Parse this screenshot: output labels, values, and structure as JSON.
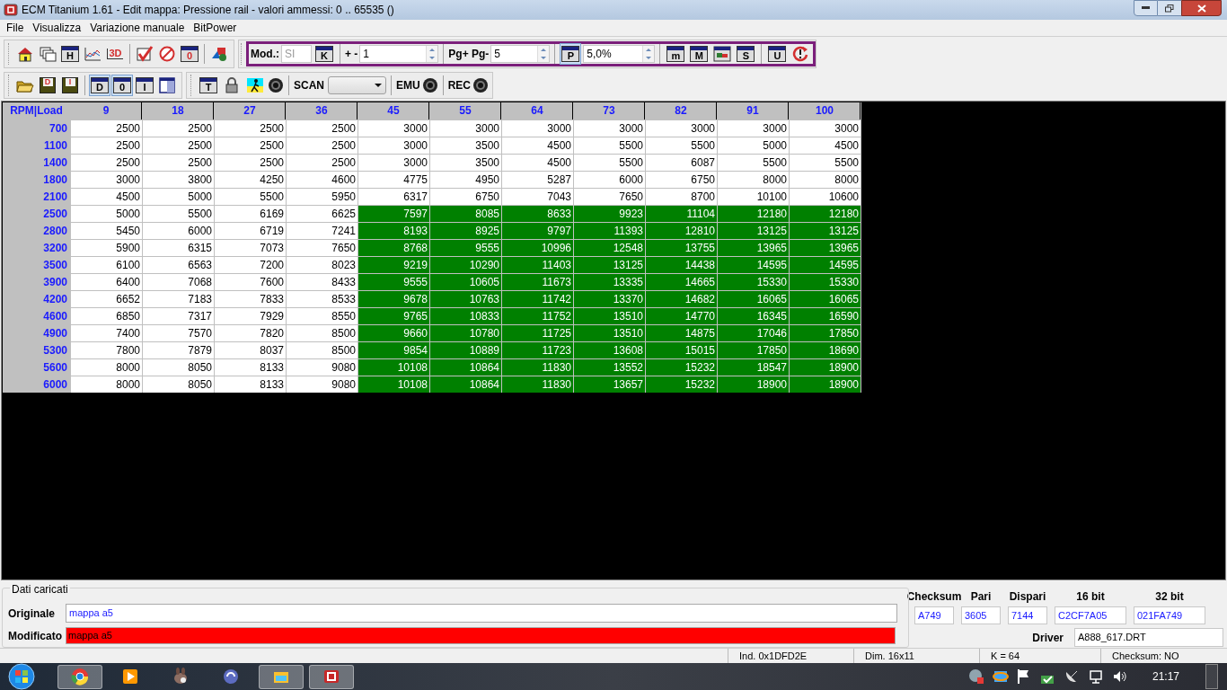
{
  "window": {
    "title": "ECM Titanium 1.61 - Edit mappa: Pressione rail - valori ammessi: 0 .. 65535 ()"
  },
  "menu": [
    "File",
    "Visualizza",
    "Variazione manuale",
    "BitPower"
  ],
  "toolbar_main": {
    "letters": [
      "H",
      "3D",
      "0"
    ]
  },
  "toolbar_edit": {
    "mod_label": "Mod.:",
    "mod_value": "SI",
    "k_letter": "K",
    "step_label": "+ -",
    "step_value": "1",
    "page_label": "Pg+ Pg-",
    "page_value": "5",
    "p_letter": "P",
    "p_selected": true,
    "percent_value": "5,0%",
    "letters": [
      "m",
      "M",
      "S",
      "U"
    ]
  },
  "toolbar_file": {
    "floppy_letters": [
      "D",
      "I"
    ],
    "view_buttons": [
      {
        "letter": "D",
        "selected": true
      },
      {
        "letter": "0",
        "selected": true
      },
      {
        "letter": "I",
        "selected": false
      }
    ]
  },
  "toolbar_scan": {
    "t_letter": "T",
    "scan_label": "SCAN",
    "emu_label": "EMU",
    "rec_label": "REC"
  },
  "table": {
    "corner": "RPM|Load",
    "columns": [
      "9",
      "18",
      "27",
      "36",
      "45",
      "55",
      "64",
      "73",
      "82",
      "91",
      "100"
    ],
    "rows": [
      {
        "rpm": "700",
        "cells": [
          {
            "value": "2500",
            "selected": false
          },
          {
            "value": "2500",
            "selected": false
          },
          {
            "value": "2500",
            "selected": false
          },
          {
            "value": "2500",
            "selected": false
          },
          {
            "value": "3000",
            "selected": false
          },
          {
            "value": "3000",
            "selected": false
          },
          {
            "value": "3000",
            "selected": false
          },
          {
            "value": "3000",
            "selected": false
          },
          {
            "value": "3000",
            "selected": false
          },
          {
            "value": "3000",
            "selected": false
          },
          {
            "value": "3000",
            "selected": false
          }
        ]
      },
      {
        "rpm": "1100",
        "cells": [
          {
            "value": "2500",
            "selected": false
          },
          {
            "value": "2500",
            "selected": false
          },
          {
            "value": "2500",
            "selected": false
          },
          {
            "value": "2500",
            "selected": false
          },
          {
            "value": "3000",
            "selected": false
          },
          {
            "value": "3500",
            "selected": false
          },
          {
            "value": "4500",
            "selected": false
          },
          {
            "value": "5500",
            "selected": false
          },
          {
            "value": "5500",
            "selected": false
          },
          {
            "value": "5000",
            "selected": false
          },
          {
            "value": "4500",
            "selected": false
          }
        ]
      },
      {
        "rpm": "1400",
        "cells": [
          {
            "value": "2500",
            "selected": false
          },
          {
            "value": "2500",
            "selected": false
          },
          {
            "value": "2500",
            "selected": false
          },
          {
            "value": "2500",
            "selected": false
          },
          {
            "value": "3000",
            "selected": false
          },
          {
            "value": "3500",
            "selected": false
          },
          {
            "value": "4500",
            "selected": false
          },
          {
            "value": "5500",
            "selected": false
          },
          {
            "value": "6087",
            "selected": false
          },
          {
            "value": "5500",
            "selected": false
          },
          {
            "value": "5500",
            "selected": false
          }
        ]
      },
      {
        "rpm": "1800",
        "cells": [
          {
            "value": "3000",
            "selected": false
          },
          {
            "value": "3800",
            "selected": false
          },
          {
            "value": "4250",
            "selected": false
          },
          {
            "value": "4600",
            "selected": false
          },
          {
            "value": "4775",
            "selected": false
          },
          {
            "value": "4950",
            "selected": false
          },
          {
            "value": "5287",
            "selected": false
          },
          {
            "value": "6000",
            "selected": false
          },
          {
            "value": "6750",
            "selected": false
          },
          {
            "value": "8000",
            "selected": false
          },
          {
            "value": "8000",
            "selected": false
          }
        ]
      },
      {
        "rpm": "2100",
        "cells": [
          {
            "value": "4500",
            "selected": false
          },
          {
            "value": "5000",
            "selected": false
          },
          {
            "value": "5500",
            "selected": false
          },
          {
            "value": "5950",
            "selected": false
          },
          {
            "value": "6317",
            "selected": false
          },
          {
            "value": "6750",
            "selected": false
          },
          {
            "value": "7043",
            "selected": false
          },
          {
            "value": "7650",
            "selected": false
          },
          {
            "value": "8700",
            "selected": false
          },
          {
            "value": "10100",
            "selected": false
          },
          {
            "value": "10600",
            "selected": false
          }
        ]
      },
      {
        "rpm": "2500",
        "cells": [
          {
            "value": "5000",
            "selected": false
          },
          {
            "value": "5500",
            "selected": false
          },
          {
            "value": "6169",
            "selected": false
          },
          {
            "value": "6625",
            "selected": false
          },
          {
            "value": "7597",
            "selected": true
          },
          {
            "value": "8085",
            "selected": true
          },
          {
            "value": "8633",
            "selected": true
          },
          {
            "value": "9923",
            "selected": true
          },
          {
            "value": "11104",
            "selected": true
          },
          {
            "value": "12180",
            "selected": true
          },
          {
            "value": "12180",
            "selected": true
          }
        ]
      },
      {
        "rpm": "2800",
        "cells": [
          {
            "value": "5450",
            "selected": false
          },
          {
            "value": "6000",
            "selected": false
          },
          {
            "value": "6719",
            "selected": false
          },
          {
            "value": "7241",
            "selected": false
          },
          {
            "value": "8193",
            "selected": true
          },
          {
            "value": "8925",
            "selected": true
          },
          {
            "value": "9797",
            "selected": true
          },
          {
            "value": "11393",
            "selected": true
          },
          {
            "value": "12810",
            "selected": true
          },
          {
            "value": "13125",
            "selected": true
          },
          {
            "value": "13125",
            "selected": true
          }
        ]
      },
      {
        "rpm": "3200",
        "cells": [
          {
            "value": "5900",
            "selected": false
          },
          {
            "value": "6315",
            "selected": false
          },
          {
            "value": "7073",
            "selected": false
          },
          {
            "value": "7650",
            "selected": false
          },
          {
            "value": "8768",
            "selected": true
          },
          {
            "value": "9555",
            "selected": true
          },
          {
            "value": "10996",
            "selected": true
          },
          {
            "value": "12548",
            "selected": true
          },
          {
            "value": "13755",
            "selected": true
          },
          {
            "value": "13965",
            "selected": true
          },
          {
            "value": "13965",
            "selected": true
          }
        ]
      },
      {
        "rpm": "3500",
        "cells": [
          {
            "value": "6100",
            "selected": false
          },
          {
            "value": "6563",
            "selected": false
          },
          {
            "value": "7200",
            "selected": false
          },
          {
            "value": "8023",
            "selected": false
          },
          {
            "value": "9219",
            "selected": true
          },
          {
            "value": "10290",
            "selected": true
          },
          {
            "value": "11403",
            "selected": true
          },
          {
            "value": "13125",
            "selected": true
          },
          {
            "value": "14438",
            "selected": true
          },
          {
            "value": "14595",
            "selected": true
          },
          {
            "value": "14595",
            "selected": true
          }
        ]
      },
      {
        "rpm": "3900",
        "cells": [
          {
            "value": "6400",
            "selected": false
          },
          {
            "value": "7068",
            "selected": false
          },
          {
            "value": "7600",
            "selected": false
          },
          {
            "value": "8433",
            "selected": false
          },
          {
            "value": "9555",
            "selected": true
          },
          {
            "value": "10605",
            "selected": true
          },
          {
            "value": "11673",
            "selected": true
          },
          {
            "value": "13335",
            "selected": true
          },
          {
            "value": "14665",
            "selected": true
          },
          {
            "value": "15330",
            "selected": true
          },
          {
            "value": "15330",
            "selected": true
          }
        ]
      },
      {
        "rpm": "4200",
        "cells": [
          {
            "value": "6652",
            "selected": false
          },
          {
            "value": "7183",
            "selected": false
          },
          {
            "value": "7833",
            "selected": false
          },
          {
            "value": "8533",
            "selected": false
          },
          {
            "value": "9678",
            "selected": true
          },
          {
            "value": "10763",
            "selected": true
          },
          {
            "value": "11742",
            "selected": true
          },
          {
            "value": "13370",
            "selected": true
          },
          {
            "value": "14682",
            "selected": true
          },
          {
            "value": "16065",
            "selected": true
          },
          {
            "value": "16065",
            "selected": true
          }
        ]
      },
      {
        "rpm": "4600",
        "cells": [
          {
            "value": "6850",
            "selected": false
          },
          {
            "value": "7317",
            "selected": false
          },
          {
            "value": "7929",
            "selected": false
          },
          {
            "value": "8550",
            "selected": false
          },
          {
            "value": "9765",
            "selected": true
          },
          {
            "value": "10833",
            "selected": true
          },
          {
            "value": "11752",
            "selected": true
          },
          {
            "value": "13510",
            "selected": true
          },
          {
            "value": "14770",
            "selected": true
          },
          {
            "value": "16345",
            "selected": true
          },
          {
            "value": "16590",
            "selected": true
          }
        ]
      },
      {
        "rpm": "4900",
        "cells": [
          {
            "value": "7400",
            "selected": false
          },
          {
            "value": "7570",
            "selected": false
          },
          {
            "value": "7820",
            "selected": false
          },
          {
            "value": "8500",
            "selected": false
          },
          {
            "value": "9660",
            "selected": true
          },
          {
            "value": "10780",
            "selected": true
          },
          {
            "value": "11725",
            "selected": true
          },
          {
            "value": "13510",
            "selected": true
          },
          {
            "value": "14875",
            "selected": true
          },
          {
            "value": "17046",
            "selected": true
          },
          {
            "value": "17850",
            "selected": true
          }
        ]
      },
      {
        "rpm": "5300",
        "cells": [
          {
            "value": "7800",
            "selected": false
          },
          {
            "value": "7879",
            "selected": false
          },
          {
            "value": "8037",
            "selected": false
          },
          {
            "value": "8500",
            "selected": false
          },
          {
            "value": "9854",
            "selected": true
          },
          {
            "value": "10889",
            "selected": true
          },
          {
            "value": "11723",
            "selected": true
          },
          {
            "value": "13608",
            "selected": true
          },
          {
            "value": "15015",
            "selected": true
          },
          {
            "value": "17850",
            "selected": true
          },
          {
            "value": "18690",
            "selected": true
          }
        ]
      },
      {
        "rpm": "5600",
        "cells": [
          {
            "value": "8000",
            "selected": false
          },
          {
            "value": "8050",
            "selected": false
          },
          {
            "value": "8133",
            "selected": false
          },
          {
            "value": "9080",
            "selected": false
          },
          {
            "value": "10108",
            "selected": true
          },
          {
            "value": "10864",
            "selected": true
          },
          {
            "value": "11830",
            "selected": true
          },
          {
            "value": "13552",
            "selected": true
          },
          {
            "value": "15232",
            "selected": true
          },
          {
            "value": "18547",
            "selected": true
          },
          {
            "value": "18900",
            "selected": true
          }
        ]
      },
      {
        "rpm": "6000",
        "cells": [
          {
            "value": "8000",
            "selected": false
          },
          {
            "value": "8050",
            "selected": false
          },
          {
            "value": "8133",
            "selected": false
          },
          {
            "value": "9080",
            "selected": false
          },
          {
            "value": "10108",
            "selected": true
          },
          {
            "value": "10864",
            "selected": true
          },
          {
            "value": "11830",
            "selected": true
          },
          {
            "value": "13657",
            "selected": true
          },
          {
            "value": "15232",
            "selected": true
          },
          {
            "value": "18900",
            "selected": true
          },
          {
            "value": "18900",
            "selected": true
          }
        ]
      }
    ]
  },
  "loaded_data": {
    "title": "Dati caricati",
    "original_label": "Originale",
    "original_value": "mappa a5",
    "modified_label": "Modificato",
    "modified_value": "mappa a5",
    "modified_changed": true
  },
  "checksums": [
    {
      "label": "Checksum",
      "value": "A749"
    },
    {
      "label": "Pari",
      "value": "3605"
    },
    {
      "label": "Dispari",
      "value": "7144"
    },
    {
      "label": "16 bit",
      "value": "C2CF7A05"
    },
    {
      "label": "32 bit",
      "value": "021FA749"
    }
  ],
  "driver": {
    "label": "Driver",
    "value": "A888_617.DRT"
  },
  "status_bar": [
    "Ind. 0x1DFD2E",
    "Dim. 16x11",
    "K = 64",
    "Checksum: NO"
  ],
  "taskbar": {
    "clock": "21:17"
  }
}
